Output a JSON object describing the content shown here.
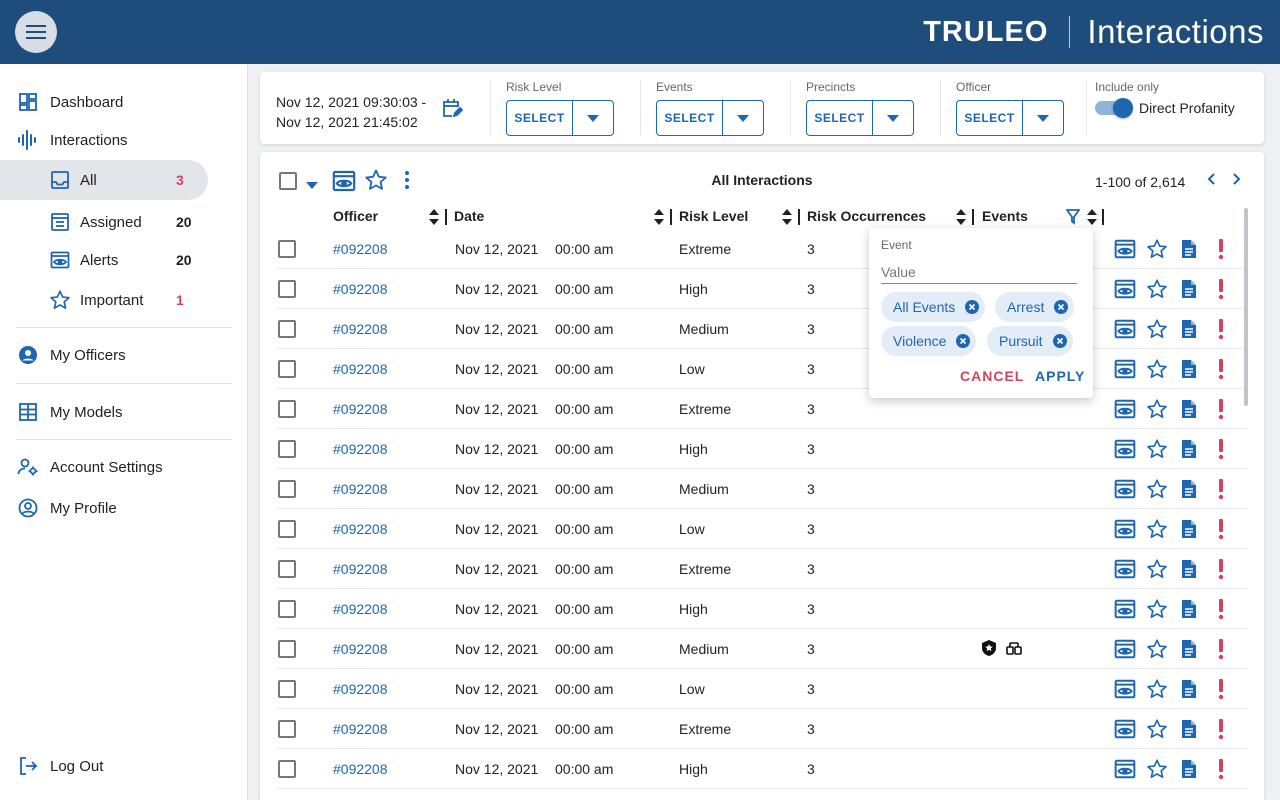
{
  "header": {
    "brand": "TRULEO",
    "section_title": "Interactions"
  },
  "sidebar": {
    "dashboard": "Dashboard",
    "interactions": "Interactions",
    "all": {
      "label": "All",
      "count": "3"
    },
    "assigned": {
      "label": "Assigned",
      "count": "20"
    },
    "alerts": {
      "label": "Alerts",
      "count": "20"
    },
    "important": {
      "label": "Important",
      "count": "1"
    },
    "my_officers": "My Officers",
    "my_models": "My Models",
    "account_settings": "Account Settings",
    "my_profile": "My Profile",
    "log_out": "Log Out"
  },
  "filters": {
    "date_from": "Nov 12, 2021 09:30:03 -",
    "date_to": "Nov 12, 2021 21:45:02",
    "risk_level": {
      "label": "Risk Level",
      "value": "SELECT"
    },
    "events": {
      "label": "Events",
      "value": "SELECT"
    },
    "precincts": {
      "label": "Precincts",
      "value": "SELECT"
    },
    "officer": {
      "label": "Officer",
      "value": "SELECT"
    },
    "include_only": {
      "label": "Include only",
      "toggle_label": "Direct Profanity",
      "on": true
    }
  },
  "table": {
    "title": "All Interactions",
    "pagination": "1-100 of 2,614",
    "columns": {
      "officer": "Officer",
      "date": "Date",
      "risk_level": "Risk Level",
      "risk_occurrences": "Risk Occurrences",
      "events": "Events"
    },
    "rows": [
      {
        "officer": "#092208",
        "date": "Nov 12, 2021",
        "time": "00:00 am",
        "risk": "Extreme",
        "occurrences": "3",
        "events": []
      },
      {
        "officer": "#092208",
        "date": "Nov 12, 2021",
        "time": "00:00 am",
        "risk": "High",
        "occurrences": "3",
        "events": []
      },
      {
        "officer": "#092208",
        "date": "Nov 12, 2021",
        "time": "00:00 am",
        "risk": "Medium",
        "occurrences": "3",
        "events": []
      },
      {
        "officer": "#092208",
        "date": "Nov 12, 2021",
        "time": "00:00 am",
        "risk": "Low",
        "occurrences": "3",
        "events": []
      },
      {
        "officer": "#092208",
        "date": "Nov 12, 2021",
        "time": "00:00 am",
        "risk": "Extreme",
        "occurrences": "3",
        "events": []
      },
      {
        "officer": "#092208",
        "date": "Nov 12, 2021",
        "time": "00:00 am",
        "risk": "High",
        "occurrences": "3",
        "events": []
      },
      {
        "officer": "#092208",
        "date": "Nov 12, 2021",
        "time": "00:00 am",
        "risk": "Medium",
        "occurrences": "3",
        "events": []
      },
      {
        "officer": "#092208",
        "date": "Nov 12, 2021",
        "time": "00:00 am",
        "risk": "Low",
        "occurrences": "3",
        "events": []
      },
      {
        "officer": "#092208",
        "date": "Nov 12, 2021",
        "time": "00:00 am",
        "risk": "Extreme",
        "occurrences": "3",
        "events": []
      },
      {
        "officer": "#092208",
        "date": "Nov 12, 2021",
        "time": "00:00 am",
        "risk": "High",
        "occurrences": "3",
        "events": []
      },
      {
        "officer": "#092208",
        "date": "Nov 12, 2021",
        "time": "00:00 am",
        "risk": "Medium",
        "occurrences": "3",
        "events": [
          "badge-icon",
          "handcuffs-icon"
        ]
      },
      {
        "officer": "#092208",
        "date": "Nov 12, 2021",
        "time": "00:00 am",
        "risk": "Low",
        "occurrences": "3",
        "events": []
      },
      {
        "officer": "#092208",
        "date": "Nov 12, 2021",
        "time": "00:00 am",
        "risk": "Extreme",
        "occurrences": "3",
        "events": []
      },
      {
        "officer": "#092208",
        "date": "Nov 12, 2021",
        "time": "00:00 am",
        "risk": "High",
        "occurrences": "3",
        "events": []
      }
    ]
  },
  "events_filter": {
    "label": "Event",
    "placeholder": "Value",
    "chips": [
      "All Events",
      "Arrest",
      "Violence",
      "Pursuit"
    ],
    "cancel": "CANCEL",
    "apply": "APPLY"
  },
  "colors": {
    "header": "#1e4d7b",
    "primary": "#1e66b0",
    "alert": "#d2445e",
    "chip_bg": "#e3edf8"
  }
}
